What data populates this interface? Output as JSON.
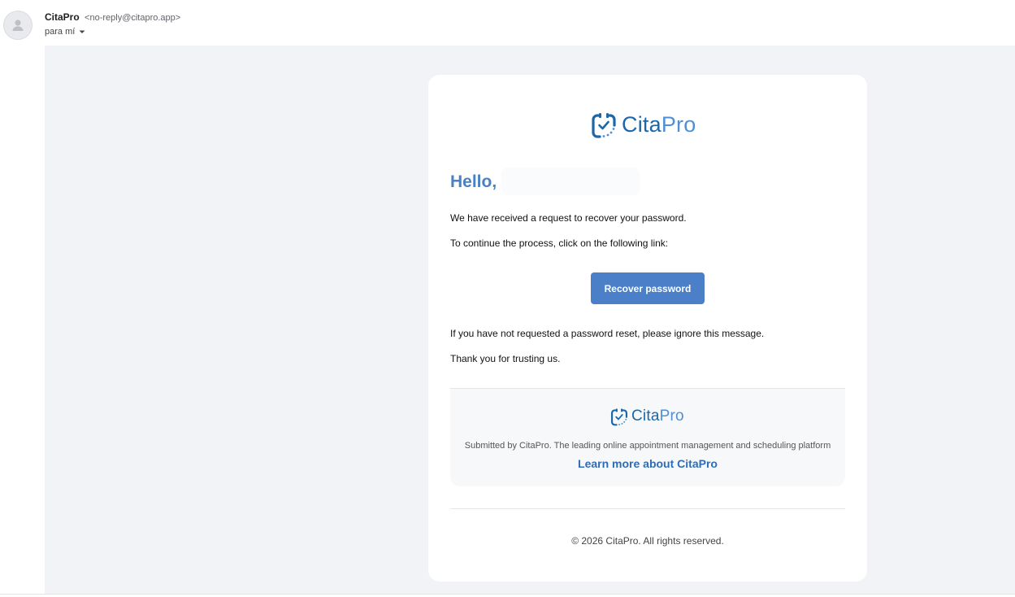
{
  "header": {
    "sender_name": "CitaPro",
    "sender_email": "<no-reply@citapro.app>",
    "to_label": "para mí",
    "avatar_icon": "person-icon",
    "dropdown_icon": "caret-down-icon"
  },
  "email": {
    "logo": {
      "cita": "Cita",
      "pro": "Pro",
      "icon": "calendar-check-icon"
    },
    "greeting": "Hello,",
    "line1": "We have received a request to recover your password.",
    "line2": "To continue the process, click on the following link:",
    "button_label": "Recover password",
    "line3": "If you have not requested a password reset, please ignore this message.",
    "line4": "Thank you for trusting us.",
    "footer": {
      "submitted": "Submitted by CitaPro. The leading online appointment management and scheduling platform",
      "learn_more": "Learn more about CitaPro"
    },
    "copyright": "© 2026 CitaPro. All rights reserved."
  },
  "colors": {
    "accent": "#4b80c8",
    "link": "#2f6cb6",
    "greeting": "#4a81c6",
    "background": "#f1f3f6"
  }
}
